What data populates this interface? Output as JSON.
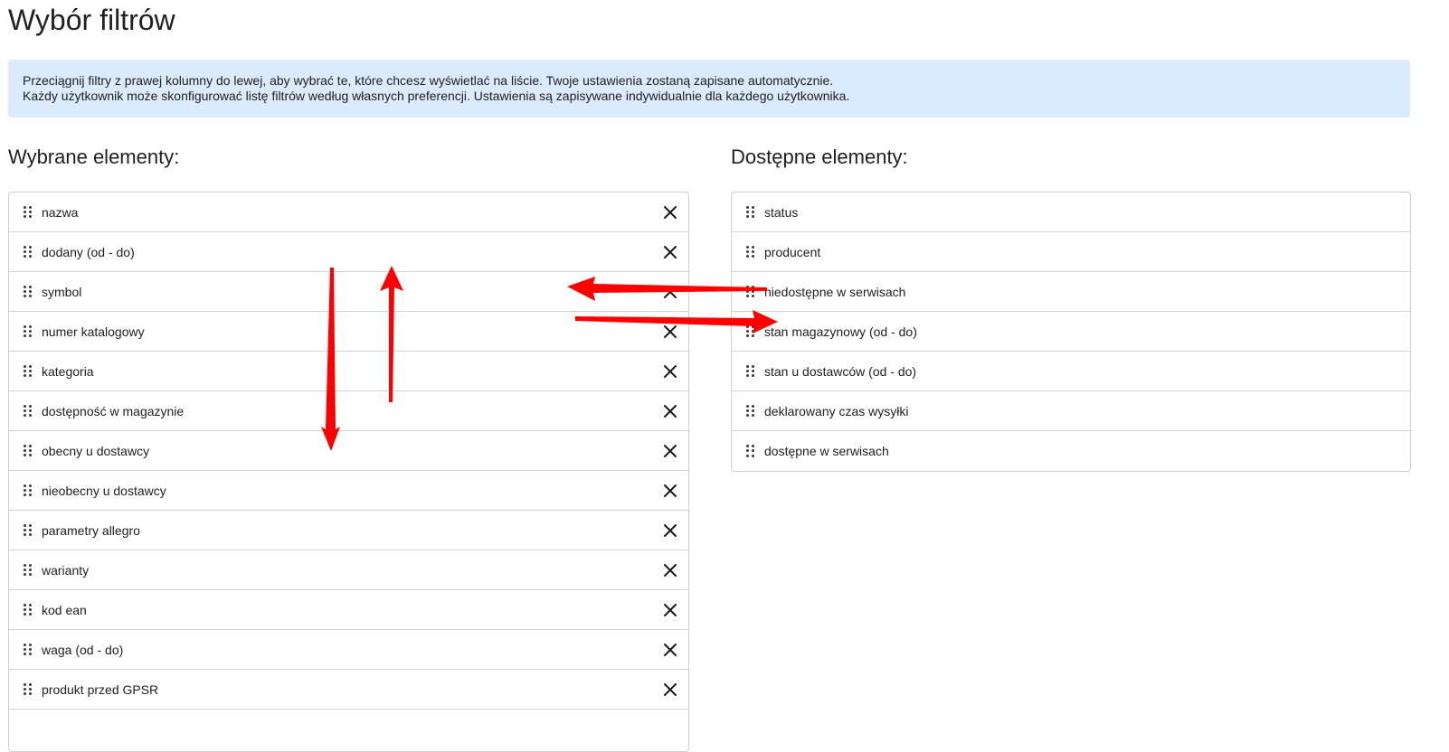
{
  "page": {
    "title": "Wybór filtrów"
  },
  "info": {
    "line1": "Przeciągnij filtry z prawej kolumny do lewej, aby wybrać te, które chcesz wyświetlać na liście. Twoje ustawienia zostaną zapisane automatycznie.",
    "line2": "Każdy użytkownik może skonfigurować listę filtrów według własnych preferencji. Ustawienia są zapisywane indywidualnie dla każdego użytkownika."
  },
  "selected": {
    "heading": "Wybrane elementy:",
    "items": [
      "nazwa",
      "dodany (od - do)",
      "symbol",
      "numer katalogowy",
      "kategoria",
      "dostępność w magazynie",
      "obecny u dostawcy",
      "nieobecny u dostawcy",
      "parametry allegro",
      "warianty",
      "kod ean",
      "waga (od - do)",
      "produkt przed GPSR"
    ]
  },
  "available": {
    "heading": "Dostępne elementy:",
    "items": [
      "status",
      "producent",
      "niedostępne w serwisach",
      "stan magazynowy (od - do)",
      "stan u dostawców (od - do)",
      "deklarowany czas wysyłki",
      "dostępne w serwisach"
    ]
  },
  "icons": {
    "drag": "drag-handle-icon",
    "remove": "close-icon",
    "annotation": "arrow-icon"
  },
  "colors": {
    "info_bg": "#dbeafc",
    "annotation": "#ff0000",
    "border": "#cfcfcf"
  }
}
